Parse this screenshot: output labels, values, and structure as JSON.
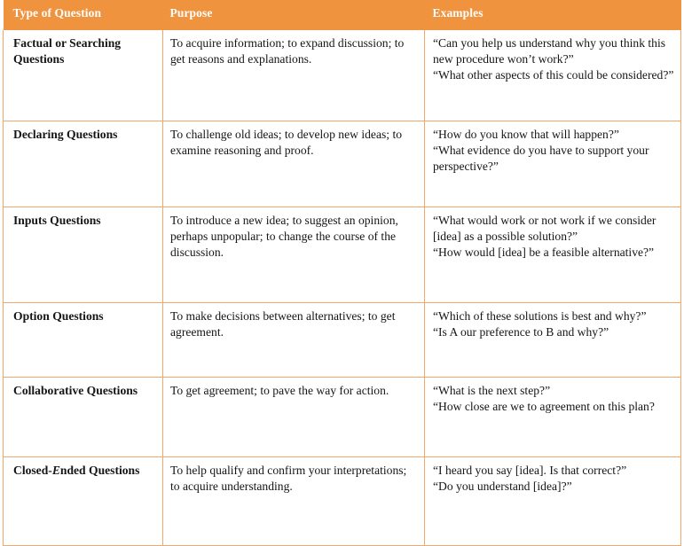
{
  "table": {
    "accent_color": "#F0933F",
    "border_color": "#F3A86A",
    "header_text_color": "#FFFFFF",
    "body_text_color": "#151515",
    "columns": [
      {
        "key": "type",
        "label": "Type of Question"
      },
      {
        "key": "purpose",
        "label": "Purpose"
      },
      {
        "key": "example",
        "label": "Examples"
      }
    ],
    "rows": [
      {
        "type": "Factual or Searching Questions",
        "purpose": "To acquire information; to expand discussion; to get reasons and explanations.",
        "examples": [
          "“Can you help us understand why you think this new procedure won’t work?”",
          "“What other aspects of this could be considered?”"
        ]
      },
      {
        "type": "Declaring Questions",
        "purpose": "To challenge old ideas; to develop new ideas; to examine reasoning and proof.",
        "examples": [
          "“How do you know that will happen?”",
          "“What evidence do you have to support your perspective?”"
        ]
      },
      {
        "type": "Inputs Questions",
        "purpose": "To introduce a new idea; to suggest an opinion, perhaps unpopular; to change the course of the discussion.",
        "examples": [
          "“What would work or not work if we consider [idea] as a possible solution?”",
          "“How would [idea] be a feasible alternative?”"
        ]
      },
      {
        "type": "Option Questions",
        "purpose": "To make decisions between alternatives; to get agreement.",
        "examples": [
          "“Which of these solutions is best and why?”",
          "“Is A our preference to B and why?”"
        ]
      },
      {
        "type": "Collaborative Questions",
        "purpose": "To get agreement; to pave the way for action.",
        "examples": [
          "“What is the next step?”",
          "“How close are we to agreement on this plan?"
        ]
      },
      {
        "type": "Closed-Ended Questions",
        "type_prefix": "Closed-",
        "type_emphasis": "E",
        "type_suffix": "nded Questions",
        "purpose": "To help qualify and confirm your interpretations; to acquire understanding.",
        "examples": [
          "“I heard you say [idea]. Is that correct?”",
          "“Do you understand [idea]?”"
        ]
      }
    ]
  }
}
